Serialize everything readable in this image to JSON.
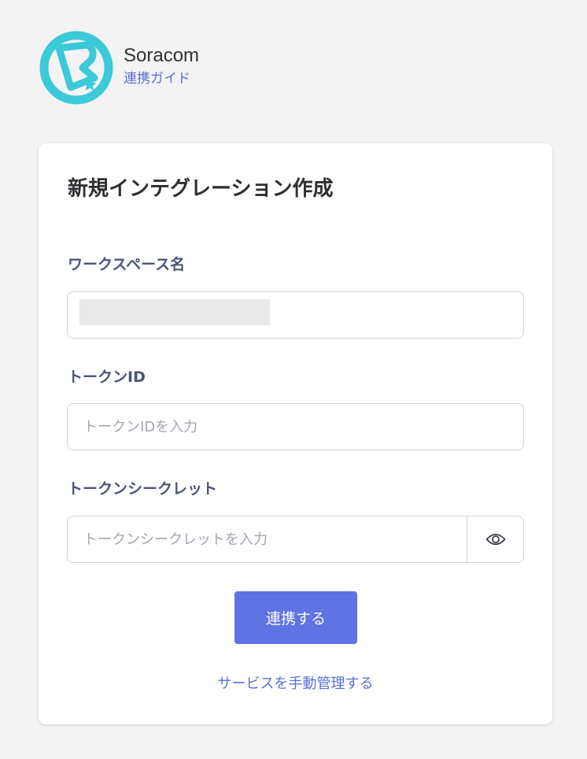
{
  "header": {
    "brand_name": "Soracom",
    "guide_link": "連携ガイド"
  },
  "form": {
    "title": "新規インテグレーション作成",
    "workspace": {
      "label": "ワークスペース名",
      "value": ""
    },
    "token_id": {
      "label": "トークンID",
      "placeholder": "トークンIDを入力",
      "value": ""
    },
    "token_secret": {
      "label": "トークンシークレット",
      "placeholder": "トークンシークレットを入力",
      "value": ""
    },
    "submit_label": "連携する",
    "manual_link": "サービスを手動管理する"
  },
  "icons": {
    "logo": "soracom-logo-icon",
    "reveal": "eye-icon"
  },
  "colors": {
    "brand_teal": "#3cc9d8",
    "accent": "#5f73e3",
    "link": "#5a6fd8",
    "label": "#4b5575"
  }
}
